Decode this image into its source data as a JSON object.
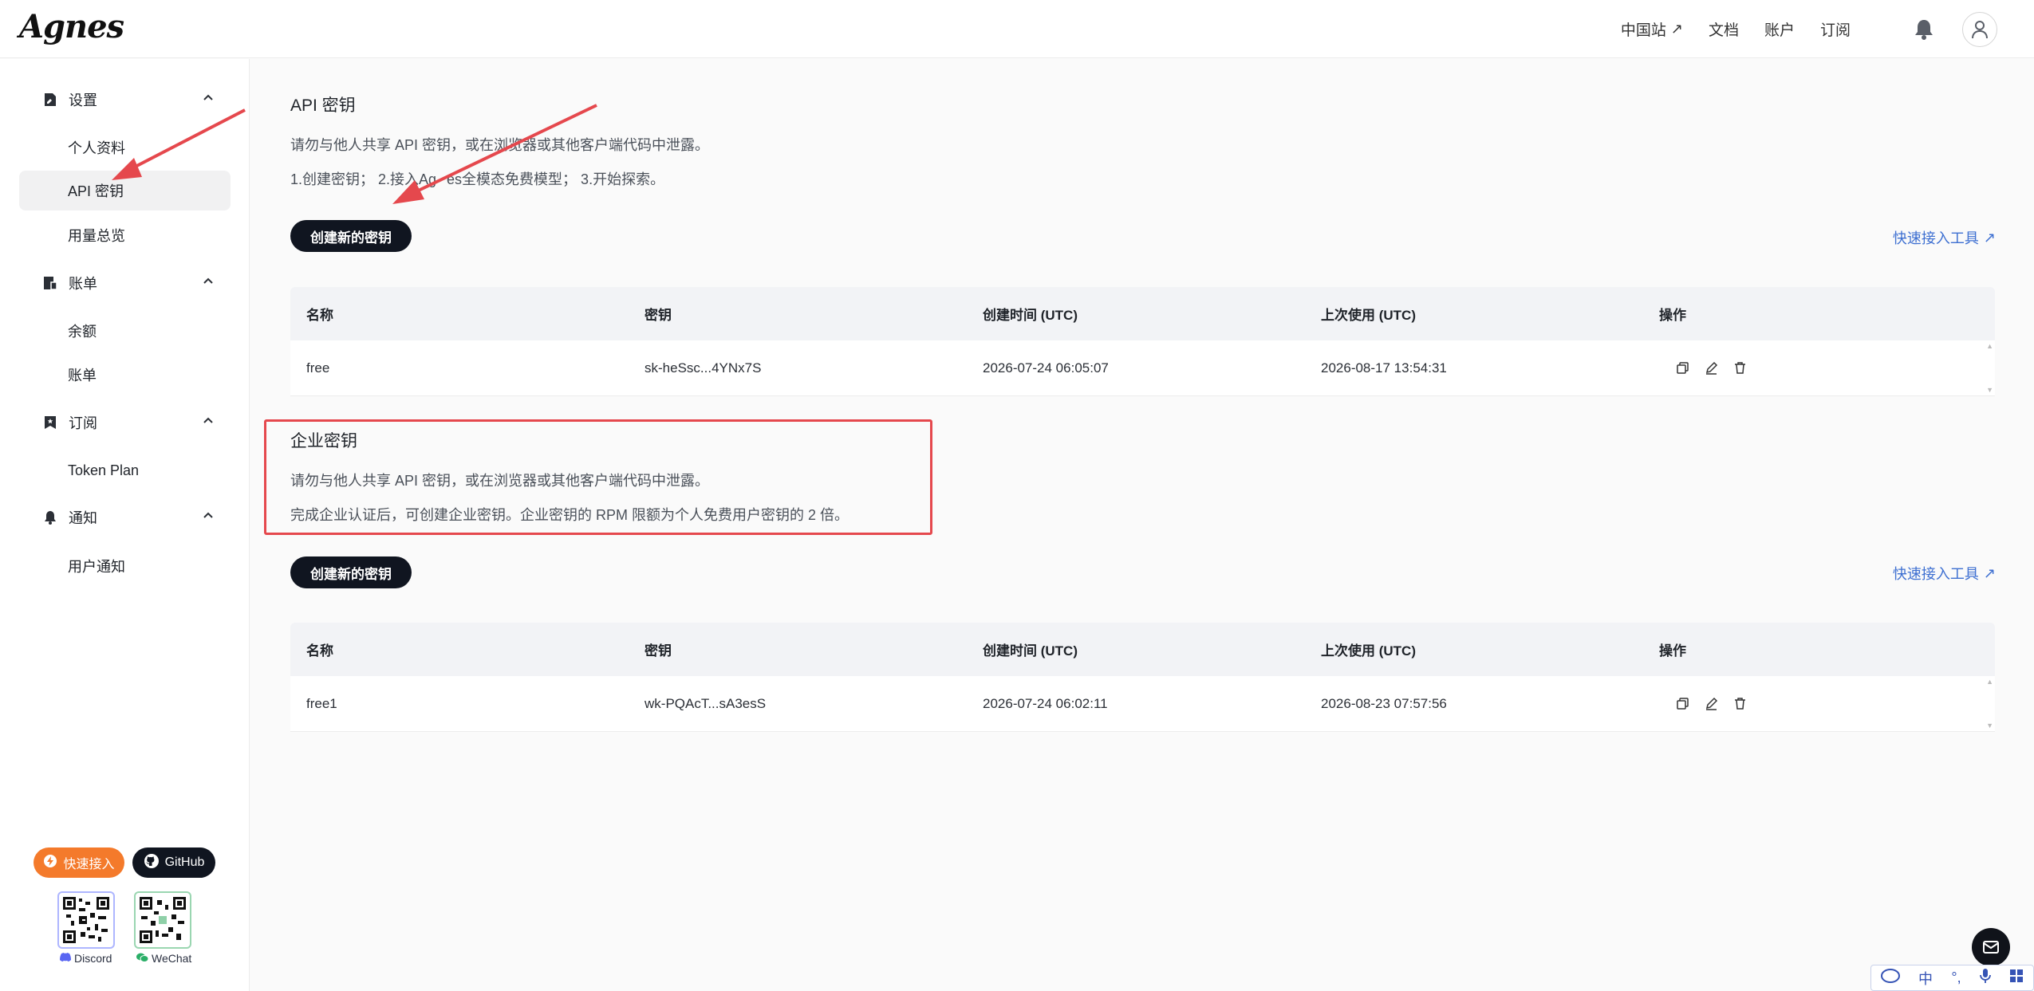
{
  "header": {
    "logo": "Agnes",
    "nav": [
      {
        "label": "中国站",
        "external": true
      },
      {
        "label": "文档"
      },
      {
        "label": "账户"
      },
      {
        "label": "订阅"
      }
    ]
  },
  "sidebar": {
    "groups": [
      {
        "label": "设置",
        "icon": "settings-doc-icon",
        "items": [
          "个人资料",
          "API 密钥",
          "用量总览"
        ]
      },
      {
        "label": "账单",
        "icon": "bill-icon",
        "items": [
          "余额",
          "账单"
        ]
      },
      {
        "label": "订阅",
        "icon": "bookmark-icon",
        "items": [
          "Token Plan"
        ]
      },
      {
        "label": "通知",
        "icon": "bell-icon",
        "items": [
          "用户通知"
        ]
      }
    ],
    "active_item": "API 密钥",
    "quick_access_label": "快速接入",
    "github_label": "GitHub",
    "discord_label": "Discord",
    "wechat_label": "WeChat"
  },
  "api_section": {
    "title": "API 密钥",
    "warning": "请勿与他人共享 API 密钥，或在浏览器或其他客户端代码中泄露。",
    "steps_before": "1.创建密钥；  2.接入Ag",
    "steps_after": "es全模态免费模型；  3.开始探索。",
    "create_button": "创建新的密钥",
    "tool_link": "快速接入工具"
  },
  "enterprise_section": {
    "title": "企业密钥",
    "warning": "请勿与他人共享 API 密钥，或在浏览器或其他客户端代码中泄露。",
    "note": "完成企业认证后，可创建企业密钥。企业密钥的 RPM 限额为个人免费用户密钥的 2 倍。",
    "create_button": "创建新的密钥",
    "tool_link": "快速接入工具"
  },
  "table_headers": [
    "名称",
    "密钥",
    "创建时间 (UTC)",
    "上次使用 (UTC)",
    "操作"
  ],
  "api_keys": [
    {
      "name": "free",
      "key": "sk-heSsc...4YNx7S",
      "created": "2026-07-24 06:05:07",
      "last_used": "2026-08-17 13:54:31"
    }
  ],
  "enterprise_keys": [
    {
      "name": "free1",
      "key": "wk-PQAcT...sA3esS",
      "created": "2026-07-24 06:02:11",
      "last_used": "2026-08-23 07:57:56"
    }
  ],
  "colors": {
    "primary_button": "#101520",
    "link": "#3d6fd1",
    "highlight_box": "#e5484d",
    "annotation_arrow": "#e5484d",
    "quick_access": "#f47a2b"
  },
  "ime": {
    "lang": "中"
  }
}
